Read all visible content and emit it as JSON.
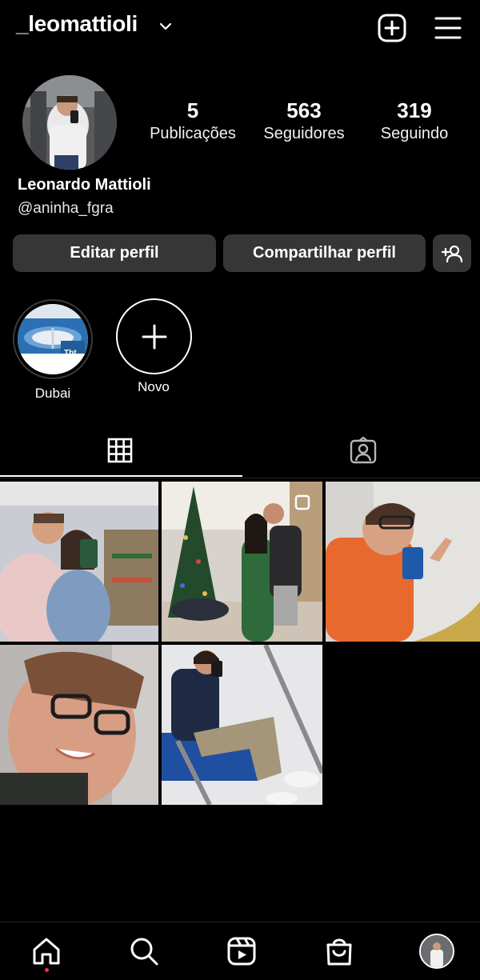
{
  "header": {
    "username": "_leomattioli",
    "icons": [
      "chevron-down-icon",
      "new-post-icon",
      "menu-icon"
    ]
  },
  "profile": {
    "stats": [
      {
        "value": "5",
        "label": "Publicações"
      },
      {
        "value": "563",
        "label": "Seguidores"
      },
      {
        "value": "319",
        "label": "Seguindo"
      }
    ],
    "full_name": "Leonardo Mattioli",
    "handle": "@aninha_fgra"
  },
  "buttons": {
    "edit": "Editar perfil",
    "share": "Compartilhar perfil",
    "add_person_icon": "add-person-icon"
  },
  "highlights": [
    {
      "label": "Dubai",
      "badge": "Tbt"
    },
    {
      "label": "Novo"
    }
  ],
  "tabs": [
    "grid-icon",
    "tagged-icon"
  ],
  "posts_count": 5,
  "bottom_nav": [
    "home-icon",
    "search-icon",
    "reels-icon",
    "shop-icon",
    "profile-avatar"
  ],
  "colors": {
    "background": "#000000",
    "button": "#363636",
    "notification_dot": "#ff3040"
  }
}
